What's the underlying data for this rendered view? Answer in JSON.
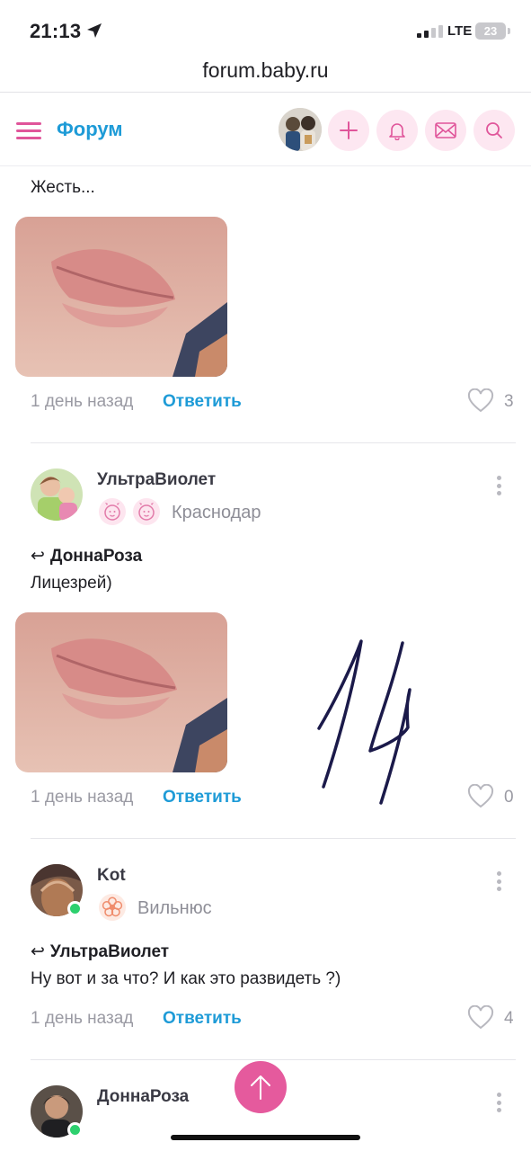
{
  "status_bar": {
    "time": "21:13",
    "network": "LTE",
    "battery": "23"
  },
  "browser": {
    "url": "forum.baby.ru"
  },
  "header": {
    "title": "Форум",
    "icons": [
      "menu-icon",
      "plus-icon",
      "bell-icon",
      "mail-icon",
      "search-icon"
    ]
  },
  "posts": [
    {
      "text": "Жесть...",
      "time": "1 день назад",
      "reply_label": "Ответить",
      "likes": "3"
    },
    {
      "author": "УльтраВиолет",
      "city": "Краснодар",
      "reply_to": "ДоннаРоза",
      "text": "Лицезрей)",
      "time": "1 день назад",
      "reply_label": "Ответить",
      "likes": "0",
      "annotation": "14"
    },
    {
      "author": "Kot",
      "city": "Вильнюс",
      "reply_to": "УльтраВиолет",
      "text": "Ну вот и за что? И как это развидеть ?)",
      "time": "1 день назад",
      "reply_label": "Ответить",
      "likes": "4"
    },
    {
      "author": "ДоннаРоза"
    }
  ],
  "colors": {
    "accent_pink": "#e55a9d",
    "link_blue": "#1e9bd7",
    "online": "#2dd06e"
  }
}
